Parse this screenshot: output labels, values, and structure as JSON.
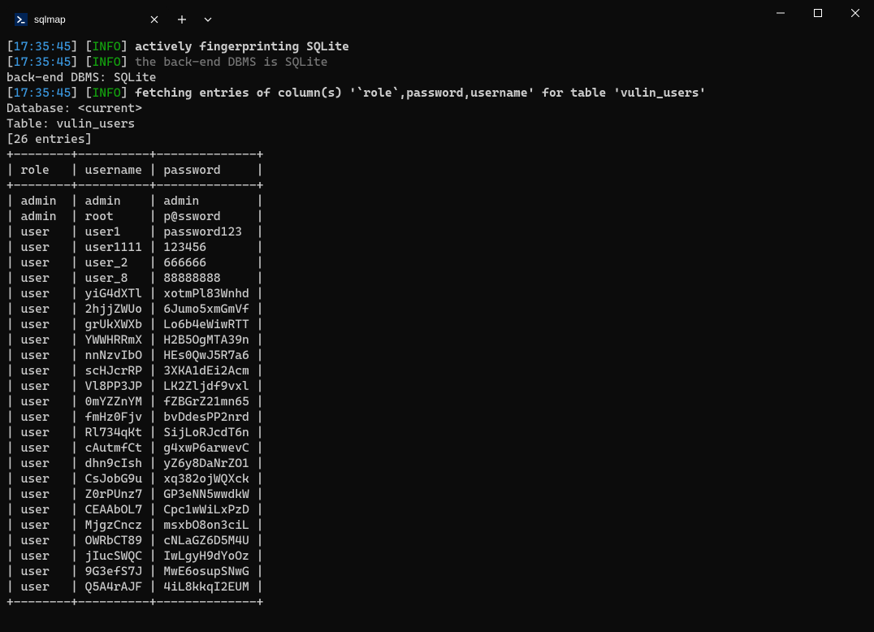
{
  "window": {
    "tab_title": "sqlmap"
  },
  "log": {
    "t1": "17:35:45",
    "t2": "17:35:45",
    "t3": "17:35:45",
    "lvl": "INFO",
    "msg1": "actively fingerprinting SQLite",
    "msg2": "the back-end DBMS is SQLite",
    "msg3": "fetching entries of column(s) '`role`,password,username' for table 'vulin_users'",
    "dbms_line": "back-end DBMS: SQLite",
    "db_line": "Database: <current>",
    "table_line": "Table: vulin_users",
    "count_line": "[26 entries]"
  },
  "table": {
    "sep": "+--------+----------+--------------+",
    "header": "| role   | username | password     |",
    "rows": [
      "| admin  | admin    | admin        |",
      "| admin  | root     | p@ssword     |",
      "| user   | user1    | password123  |",
      "| user   | user1111 | 123456       |",
      "| user   | user_2   | 666666       |",
      "| user   | user_8   | 88888888     |",
      "| user   | yiG4dXTl | xotmPl83Wnhd |",
      "| user   | 2hjjZWUo | 6Jumo5xmGmVf |",
      "| user   | grUkXWXb | Lo6b4eWiwRTT |",
      "| user   | YWWHRRmX | H2B5OgMTA39n |",
      "| user   | nnNzvIbO | HEs0QwJ5R7a6 |",
      "| user   | scHJcrRP | 3XKA1dEi2Acm |",
      "| user   | Vl8PP3JP | LK2Zljdf9vxl |",
      "| user   | 0mYZZnYM | fZBGrZ21mn65 |",
      "| user   | fmHz0Fjv | bvDdesPP2nrd |",
      "| user   | Rl734qKt | SijLoRJcdT6n |",
      "| user   | cAutmfCt | g4xwP6arwevC |",
      "| user   | dhn9cIsh | yZ6y8DaNrZO1 |",
      "| user   | CsJobG9u | xq382ojWQXck |",
      "| user   | Z0rPUnz7 | GP3eNN5wwdkW |",
      "| user   | CEAAbOL7 | Cpc1wWiLxPzD |",
      "| user   | MjgzCncz | msxbO8on3ciL |",
      "| user   | OWRbCT89 | cNLaGZ6D5M4U |",
      "| user   | jIucSWQC | IwLgyH9dYoOz |",
      "| user   | 9G3efS7J | MwE6osupSNwG |",
      "| user   | Q5A4rAJF | 4iL8kkqI2EUM |"
    ]
  }
}
